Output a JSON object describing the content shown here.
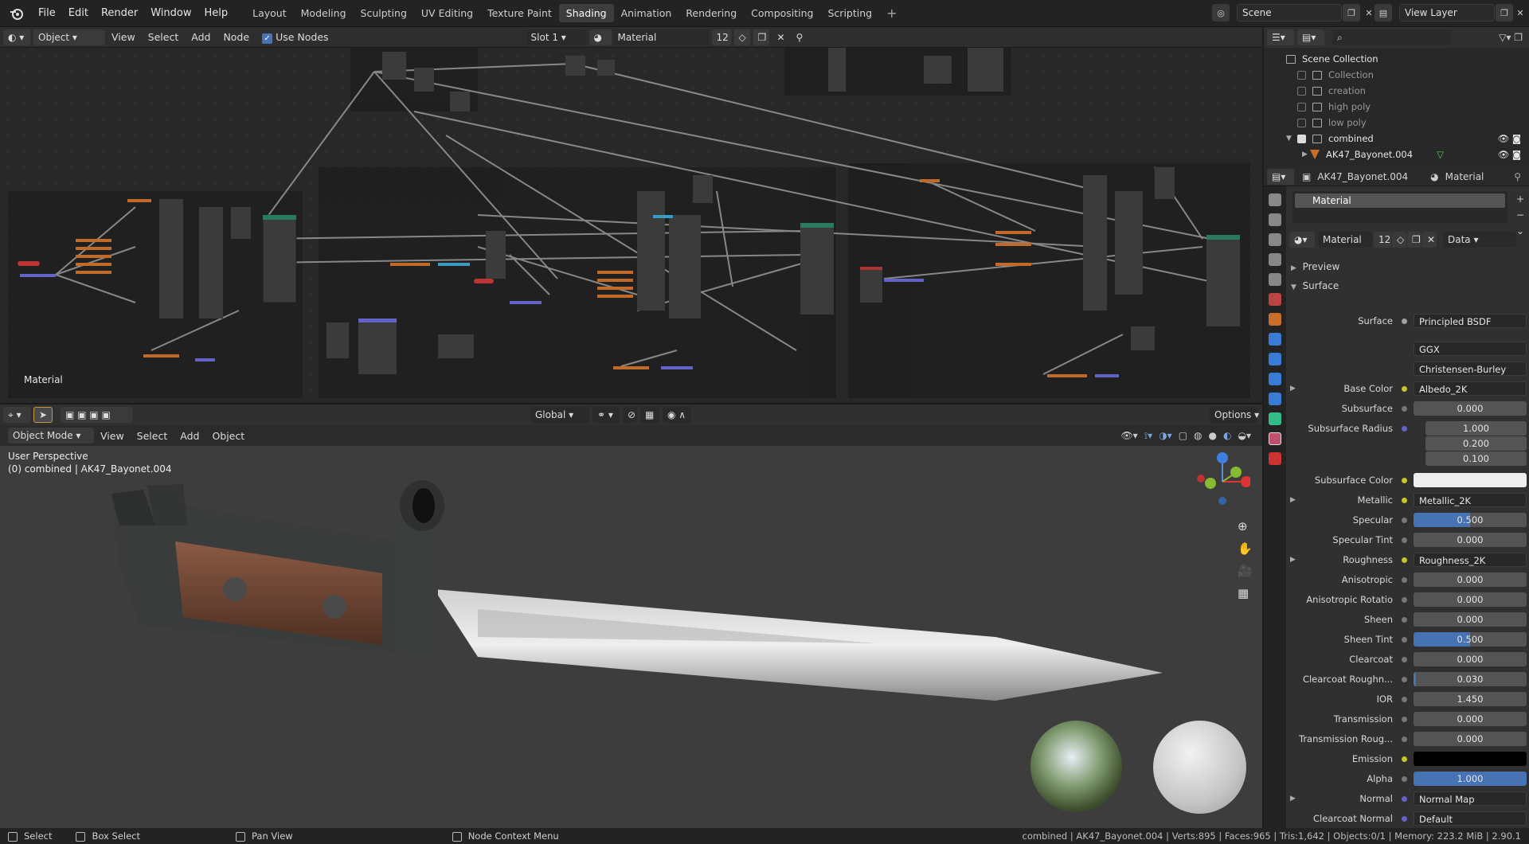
{
  "menu": [
    "File",
    "Edit",
    "Render",
    "Window",
    "Help"
  ],
  "workspaces": [
    "Layout",
    "Modeling",
    "Sculpting",
    "UV Editing",
    "Texture Paint",
    "Shading",
    "Animation",
    "Rendering",
    "Compositing",
    "Scripting"
  ],
  "active_workspace": "Shading",
  "scene": "Scene",
  "view_layer": "View Layer",
  "node_header": {
    "object_mode": "Object",
    "items": [
      "View",
      "Select",
      "Add",
      "Node"
    ],
    "use_nodes": "Use Nodes",
    "slot": "Slot 1",
    "material": "Material",
    "users": "12"
  },
  "node_editor_label": "Material",
  "viewport_header": {
    "orientation": "Global",
    "options": "Options",
    "mode": "Object Mode",
    "items": [
      "View",
      "Select",
      "Add",
      "Object"
    ]
  },
  "viewport": {
    "perspective": "User Perspective",
    "object_info": "(0) combined | AK47_Bayonet.004"
  },
  "outliner": {
    "root": "Scene Collection",
    "rows": [
      "Collection",
      "creation",
      "high poly",
      "low poly",
      "combined",
      "AK47_Bayonet.004"
    ]
  },
  "props_header": {
    "object": "AK47_Bayonet.004",
    "context": "Material"
  },
  "material_slot": "Material",
  "material_selector": {
    "name": "Material",
    "users": "12",
    "link": "Data"
  },
  "panels": {
    "preview": "Preview",
    "surface": "Surface"
  },
  "properties": [
    {
      "label": "Surface",
      "value": "Principled BSDF",
      "kind": "link"
    },
    {
      "label": "",
      "value": "GGX",
      "kind": "menu"
    },
    {
      "label": "",
      "value": "Christensen-Burley",
      "kind": "menu"
    },
    {
      "label": "Base Color",
      "value": "Albedo_2K",
      "kind": "link"
    },
    {
      "label": "Subsurface",
      "value": "0.000",
      "kind": "num"
    },
    {
      "label": "Subsurface Radius",
      "value": "1.000",
      "kind": "num"
    },
    {
      "label": "",
      "value": "0.200",
      "kind": "num"
    },
    {
      "label": "",
      "value": "0.100",
      "kind": "num"
    },
    {
      "label": "Subsurface Color",
      "value": "",
      "kind": "color"
    },
    {
      "label": "Metallic",
      "value": "Metallic_2K",
      "kind": "link"
    },
    {
      "label": "Specular",
      "value": "0.500",
      "kind": "half"
    },
    {
      "label": "Specular Tint",
      "value": "0.000",
      "kind": "num"
    },
    {
      "label": "Roughness",
      "value": "Roughness_2K",
      "kind": "link"
    },
    {
      "label": "Anisotropic",
      "value": "0.000",
      "kind": "num"
    },
    {
      "label": "Anisotropic Rotatio",
      "value": "0.000",
      "kind": "num"
    },
    {
      "label": "Sheen",
      "value": "0.000",
      "kind": "num"
    },
    {
      "label": "Sheen Tint",
      "value": "0.500",
      "kind": "half"
    },
    {
      "label": "Clearcoat",
      "value": "0.000",
      "kind": "num"
    },
    {
      "label": "Clearcoat Roughn...",
      "value": "0.030",
      "kind": "thin"
    },
    {
      "label": "IOR",
      "value": "1.450",
      "kind": "num"
    },
    {
      "label": "Transmission",
      "value": "0.000",
      "kind": "num"
    },
    {
      "label": "Transmission Roug...",
      "value": "0.000",
      "kind": "num"
    },
    {
      "label": "Emission",
      "value": "",
      "kind": "black"
    },
    {
      "label": "Alpha",
      "value": "1.000",
      "kind": "full"
    },
    {
      "label": "Normal",
      "value": "Normal Map",
      "kind": "link"
    },
    {
      "label": "Clearcoat Normal",
      "value": "Default",
      "kind": "link"
    }
  ],
  "status": {
    "select": "Select",
    "box_select": "Box Select",
    "pan_view": "Pan View",
    "context_menu": "Node Context Menu",
    "stats": "combined | AK47_Bayonet.004 | Verts:895 | Faces:965 | Tris:1,642 | Objects:0/1 | Memory: 223.2 MiB | 2.90.1"
  }
}
